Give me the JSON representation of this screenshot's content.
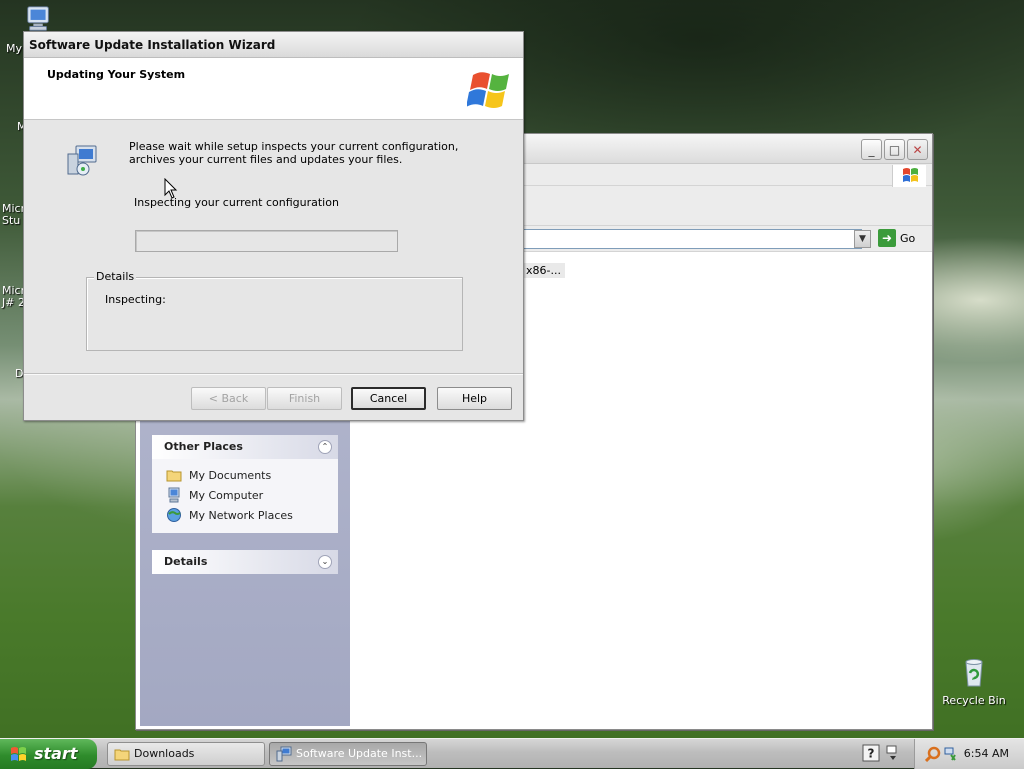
{
  "desktop": {
    "icons": [
      {
        "label": "My",
        "icon": "my-computer-icon"
      },
      {
        "label": "M",
        "icon": "desktop-shortcut-icon"
      },
      {
        "label": "Micr\nStu",
        "icon": "desktop-shortcut-icon"
      },
      {
        "label": "Micr\nJ# 2",
        "icon": "desktop-shortcut-icon"
      },
      {
        "label": "D",
        "icon": "desktop-shortcut-icon"
      },
      {
        "label": "Recycle Bin",
        "icon": "recycle-bin-icon"
      }
    ]
  },
  "explorer": {
    "address_go_label": "Go",
    "file_item_label": "x86-...",
    "other_places": {
      "title": "Other Places",
      "links": [
        {
          "label": "My Documents",
          "icon": "folder-icon"
        },
        {
          "label": "My Computer",
          "icon": "my-computer-icon"
        },
        {
          "label": "My Network Places",
          "icon": "network-places-icon"
        }
      ]
    },
    "details_panel": {
      "title": "Details"
    }
  },
  "wizard": {
    "title": "Software Update Installation Wizard",
    "header_title": "Updating Your System",
    "description": "Please wait while setup inspects your current configuration, archives your current files and updates your files.",
    "status_text": "Inspecting your current configuration",
    "progress": 0,
    "details_legend": "Details",
    "details_text": "Inspecting:",
    "buttons": {
      "back": "< Back",
      "finish": "Finish",
      "cancel": "Cancel",
      "help": "Help"
    }
  },
  "taskbar": {
    "start_label": "start",
    "tasks": [
      {
        "label": "Downloads",
        "icon": "folder-icon"
      },
      {
        "label": "Software Update Inst...",
        "icon": "setup-icon"
      }
    ],
    "clock": "6:54 AM"
  },
  "colors": {
    "start_green": "#2f8c2c",
    "progress_blue": "#3a6fd1"
  }
}
